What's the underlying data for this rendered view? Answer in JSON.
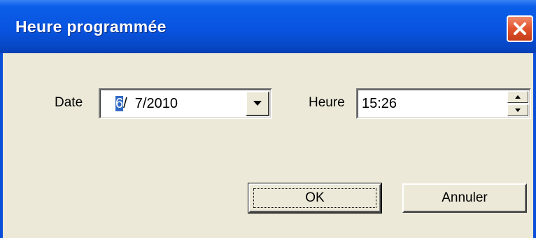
{
  "window": {
    "title": "Heure programmée"
  },
  "form": {
    "date_label": "Date",
    "date_day_selected": "6",
    "date_rest": "/  7/2010",
    "time_label": "Heure",
    "time_value": "15:26"
  },
  "buttons": {
    "ok_label": "OK",
    "cancel_label": "Annuler"
  },
  "icons": {
    "close": "close-icon",
    "dropdown": "triangle-down-icon",
    "spin_up": "triangle-up-icon",
    "spin_down": "triangle-down-icon"
  },
  "colors": {
    "titlebar": "#0954e0",
    "close_button": "#e2532c",
    "dialog_bg": "#ece9d8",
    "selection": "#316ac5"
  }
}
